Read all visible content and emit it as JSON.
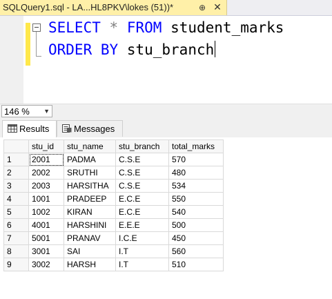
{
  "document_tab": {
    "title": "SQLQuery1.sql - LA...HL8PKV\\lokes (51))*",
    "pin_glyph": "⊕",
    "close_glyph": "✕"
  },
  "editor": {
    "line1": {
      "kw1": "SELECT",
      "op": "*",
      "kw2": "FROM",
      "id": "student_marks"
    },
    "line2": {
      "kw": "ORDER BY",
      "id": "stu_branch"
    },
    "colors": {
      "keyword": "#0000ff",
      "operator": "#808080",
      "change_bar": "#ffe84a"
    }
  },
  "zoom": {
    "value": "146 %"
  },
  "results_tabs": [
    {
      "label": "Results",
      "icon": "grid-icon",
      "active": true
    },
    {
      "label": "Messages",
      "icon": "messages-icon",
      "active": false
    }
  ],
  "grid": {
    "columns": [
      "stu_id",
      "stu_name",
      "stu_branch",
      "total_marks"
    ],
    "rows": [
      {
        "n": "1",
        "stu_id": "2001",
        "stu_name": "PADMA",
        "stu_branch": "C.S.E",
        "total_marks": "570"
      },
      {
        "n": "2",
        "stu_id": "2002",
        "stu_name": "SRUTHI",
        "stu_branch": "C.S.E",
        "total_marks": "480"
      },
      {
        "n": "3",
        "stu_id": "2003",
        "stu_name": "HARSITHA",
        "stu_branch": "C.S.E",
        "total_marks": "534"
      },
      {
        "n": "4",
        "stu_id": "1001",
        "stu_name": "PRADEEP",
        "stu_branch": "E.C.E",
        "total_marks": "550"
      },
      {
        "n": "5",
        "stu_id": "1002",
        "stu_name": "KIRAN",
        "stu_branch": "E.C.E",
        "total_marks": "540"
      },
      {
        "n": "6",
        "stu_id": "4001",
        "stu_name": "HARSHINI",
        "stu_branch": "E.E.E",
        "total_marks": "500"
      },
      {
        "n": "7",
        "stu_id": "5001",
        "stu_name": "PRANAV",
        "stu_branch": "I.C.E",
        "total_marks": "450"
      },
      {
        "n": "8",
        "stu_id": "3001",
        "stu_name": "SAI",
        "stu_branch": "I.T",
        "total_marks": "560"
      },
      {
        "n": "9",
        "stu_id": "3002",
        "stu_name": "HARSH",
        "stu_branch": "I.T",
        "total_marks": "510"
      }
    ]
  }
}
